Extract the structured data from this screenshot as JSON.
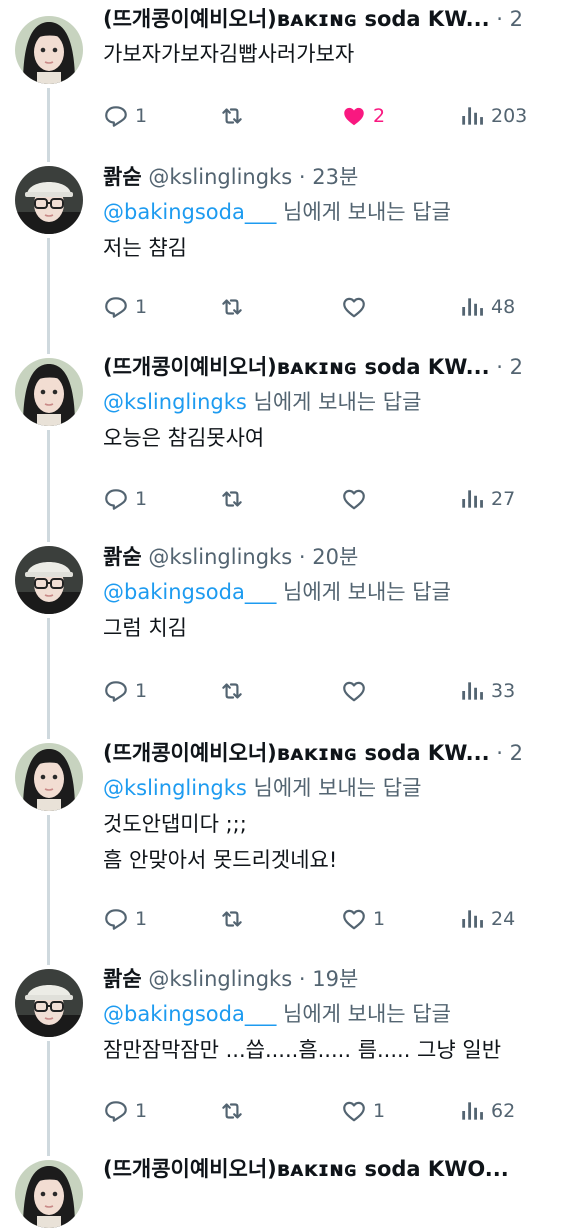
{
  "tweets": [
    {
      "author_kind": "baking",
      "name": "(뜨개콩이예비오너)ʙᴀᴋɪɴɢ soda KW...",
      "handle": "",
      "dot": "·",
      "time": "2",
      "reply_handle": "",
      "reply_text": "",
      "lines": [
        "가보자가보자김빱사러가보자"
      ],
      "replies": "1",
      "retweets": "",
      "likes": "2",
      "liked": true,
      "views": "203"
    },
    {
      "author_kind": "kslingling",
      "name": "콹숟",
      "handle": "@kslinglingks",
      "dot": "·",
      "time": "23분",
      "reply_handle": "@bakingsoda___",
      "reply_text": " 님에게 보내는 답글",
      "lines": [
        "저는 챰김"
      ],
      "replies": "1",
      "retweets": "",
      "likes": "",
      "liked": false,
      "views": "48"
    },
    {
      "author_kind": "baking",
      "name": "(뜨개콩이예비오너)ʙᴀᴋɪɴɢ soda KW...",
      "handle": "",
      "dot": "·",
      "time": "2",
      "reply_handle": "@kslinglingks",
      "reply_text": " 님에게 보내는 답글",
      "lines": [
        "오능은 참김못사여"
      ],
      "replies": "1",
      "retweets": "",
      "likes": "",
      "liked": false,
      "views": "27"
    },
    {
      "author_kind": "kslingling",
      "name": "콹숟",
      "handle": "@kslinglingks",
      "dot": "·",
      "time": "20분",
      "reply_handle": "@bakingsoda___",
      "reply_text": " 님에게 보내는 답글",
      "lines": [
        "그럼 치김"
      ],
      "replies": "1",
      "retweets": "",
      "likes": "",
      "liked": false,
      "views": "33"
    },
    {
      "author_kind": "baking",
      "name": "(뜨개콩이예비오너)ʙᴀᴋɪɴɢ soda KW...",
      "handle": "",
      "dot": "·",
      "time": "2",
      "reply_handle": "@kslinglingks",
      "reply_text": " 님에게 보내는 답글",
      "lines": [
        "것도안댑미다 ;;;",
        "흠 안맞아서 못드리겟네요!"
      ],
      "replies": "1",
      "retweets": "",
      "likes": "1",
      "liked": false,
      "views": "24"
    },
    {
      "author_kind": "kslingling",
      "name": "콹숟",
      "handle": "@kslinglingks",
      "dot": "·",
      "time": "19분",
      "reply_handle": "@bakingsoda___",
      "reply_text": " 님에게 보내는 답글",
      "lines": [
        "잠만잠막잠만 ...씁.....흠..... 름..... 그냥 일반"
      ],
      "replies": "1",
      "retweets": "",
      "likes": "1",
      "liked": false,
      "views": "62"
    },
    {
      "author_kind": "baking",
      "name": "(뜨개콩이예비오너)ʙᴀᴋɪɴɢ soda KWO...",
      "handle": "",
      "dot": "·",
      "time": "",
      "reply_handle": "",
      "reply_text": "",
      "lines": [],
      "replies": "",
      "retweets": "",
      "likes": "",
      "liked": false,
      "views": ""
    }
  ],
  "colors": {
    "text": "#0f1419",
    "secondary": "#536471",
    "link": "#1d9bf0",
    "like": "#f91880",
    "thread_line": "#cfd9de"
  },
  "icons": {
    "reply": "reply-bubble-icon",
    "retweet": "retweet-arrows-icon",
    "like": "heart-icon",
    "views": "views-bar-chart-icon"
  }
}
